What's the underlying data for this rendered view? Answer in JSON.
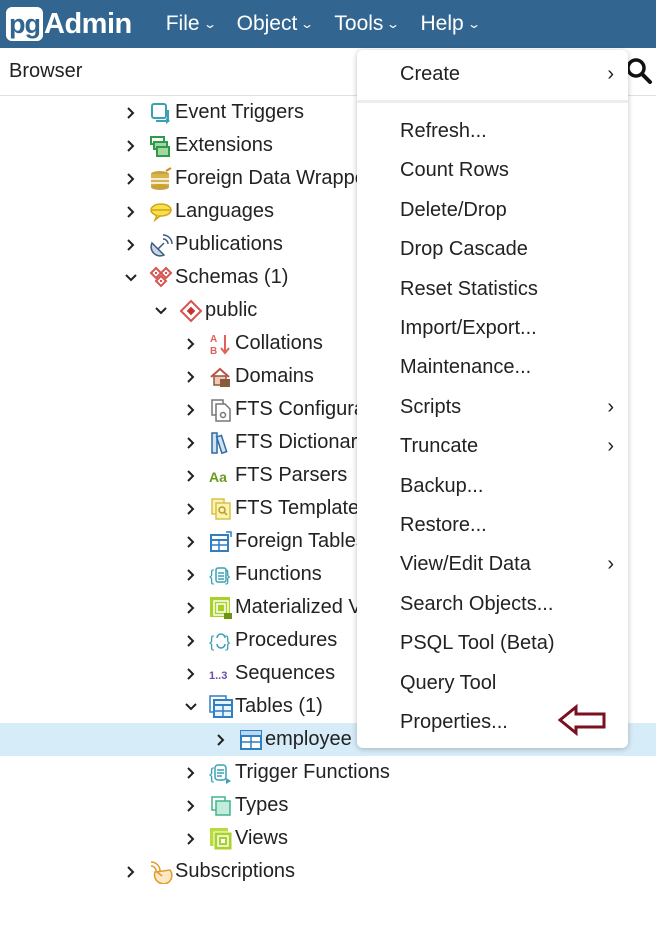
{
  "app": {
    "logo_pg": "pg",
    "logo_admin": "Admin",
    "brand_color": "#326690"
  },
  "nav": [
    {
      "label": "File",
      "icon": "chevron-down-icon"
    },
    {
      "label": "Object",
      "icon": "chevron-down-icon"
    },
    {
      "label": "Tools",
      "icon": "chevron-down-icon"
    },
    {
      "label": "Help",
      "icon": "chevron-down-icon"
    }
  ],
  "browser": {
    "title": "Browser",
    "search_icon": "search-icon"
  },
  "tree": [
    {
      "label": "Event Triggers",
      "icon": "event-trigger-icon",
      "expanded": false,
      "level": 0
    },
    {
      "label": "Extensions",
      "icon": "extension-icon",
      "expanded": false,
      "level": 0
    },
    {
      "label": "Foreign Data Wrappe",
      "icon": "foreign-data-wrapper-icon",
      "expanded": false,
      "level": 0
    },
    {
      "label": "Languages",
      "icon": "language-icon",
      "expanded": false,
      "level": 0
    },
    {
      "label": "Publications",
      "icon": "publication-icon",
      "expanded": false,
      "level": 0
    },
    {
      "label": "Schemas (1)",
      "icon": "schemas-icon",
      "expanded": true,
      "level": 0
    },
    {
      "label": "public",
      "icon": "schema-icon",
      "expanded": true,
      "level": 1
    },
    {
      "label": "Collations",
      "icon": "collation-icon",
      "expanded": false,
      "level": 2
    },
    {
      "label": "Domains",
      "icon": "domain-icon",
      "expanded": false,
      "level": 2
    },
    {
      "label": "FTS Configura",
      "icon": "fts-configuration-icon",
      "expanded": false,
      "level": 2
    },
    {
      "label": "FTS Dictionari",
      "icon": "fts-dictionary-icon",
      "expanded": false,
      "level": 2
    },
    {
      "label": "FTS Parsers",
      "icon": "fts-parser-icon",
      "expanded": false,
      "level": 2
    },
    {
      "label": "FTS Template",
      "icon": "fts-template-icon",
      "expanded": false,
      "level": 2
    },
    {
      "label": "Foreign Tables",
      "icon": "foreign-table-icon",
      "expanded": false,
      "level": 2
    },
    {
      "label": "Functions",
      "icon": "function-icon",
      "expanded": false,
      "level": 2
    },
    {
      "label": "Materialized V",
      "icon": "materialized-view-icon",
      "expanded": false,
      "level": 2
    },
    {
      "label": "Procedures",
      "icon": "procedure-icon",
      "expanded": false,
      "level": 2
    },
    {
      "label": "Sequences",
      "icon": "sequence-icon",
      "expanded": false,
      "level": 2
    },
    {
      "label": "Tables (1)",
      "icon": "tables-icon",
      "expanded": true,
      "level": 2
    },
    {
      "label": "employee",
      "icon": "table-icon",
      "expanded": false,
      "level": 3,
      "selected": true
    },
    {
      "label": "Trigger Functions",
      "icon": "trigger-function-icon",
      "expanded": false,
      "level": 2
    },
    {
      "label": "Types",
      "icon": "type-icon",
      "expanded": false,
      "level": 2
    },
    {
      "label": "Views",
      "icon": "view-icon",
      "expanded": false,
      "level": 2
    },
    {
      "label": "Subscriptions",
      "icon": "subscription-icon",
      "expanded": false,
      "level": 0
    }
  ],
  "menu": {
    "items": [
      {
        "label": "Create",
        "submenu": true
      },
      {
        "label": "Refresh...",
        "submenu": false
      },
      {
        "label": "Count Rows",
        "submenu": false
      },
      {
        "label": "Delete/Drop",
        "submenu": false
      },
      {
        "label": "Drop Cascade",
        "submenu": false
      },
      {
        "label": "Reset Statistics",
        "submenu": false
      },
      {
        "label": "Import/Export...",
        "submenu": false
      },
      {
        "label": "Maintenance...",
        "submenu": false
      },
      {
        "label": "Scripts",
        "submenu": true
      },
      {
        "label": "Truncate",
        "submenu": true
      },
      {
        "label": "Backup...",
        "submenu": false
      },
      {
        "label": "Restore...",
        "submenu": false
      },
      {
        "label": "View/Edit Data",
        "submenu": true
      },
      {
        "label": "Search Objects...",
        "submenu": false
      },
      {
        "label": "PSQL Tool (Beta)",
        "submenu": false
      },
      {
        "label": "Query Tool",
        "submenu": false
      },
      {
        "label": "Properties...",
        "submenu": false
      }
    ],
    "submenu_arrow": "›"
  },
  "annotation": {
    "icon": "left-arrow-icon",
    "points_to": "Properties...",
    "color": "#7a1020"
  },
  "colors": {
    "selected_row": "#d6ecf8",
    "text": "#222222"
  }
}
